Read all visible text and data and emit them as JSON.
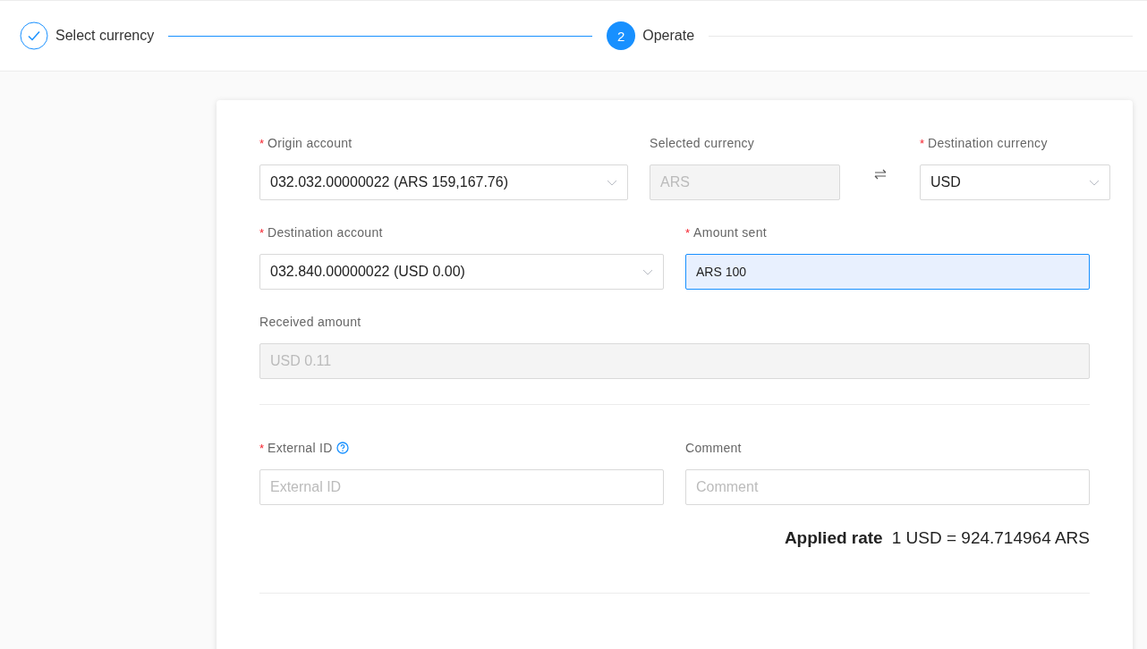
{
  "steps": [
    {
      "label": "Select currency",
      "kind": "done"
    },
    {
      "label": "Operate",
      "kind": "active",
      "number": "2"
    }
  ],
  "form": {
    "rows": [
      {
        "kind": "triple",
        "fields": [
          {
            "kind": "select",
            "label": "Origin account",
            "required_mark": "*",
            "value": "032.032.00000022 (ARS 159,167.76)"
          },
          {
            "kind": "readonly",
            "label": "Selected currency",
            "value": "ARS"
          },
          {
            "kind": "swap"
          },
          {
            "kind": "select",
            "label": "Destination currency",
            "required_mark": "*",
            "value": "USD"
          }
        ]
      },
      {
        "kind": "half",
        "fields": [
          {
            "kind": "select",
            "label": "Destination account",
            "required_mark": "*",
            "value": "032.840.00000022 (USD 0.00)"
          },
          {
            "kind": "input",
            "label": "Amount sent",
            "required_mark": "*",
            "value": "ARS 100",
            "focused": true
          }
        ]
      },
      {
        "kind": "full",
        "fields": [
          {
            "kind": "readonly",
            "label": "Received amount",
            "value": "USD 0.11"
          }
        ]
      },
      {
        "kind": "divider"
      },
      {
        "kind": "half",
        "fields": [
          {
            "kind": "input",
            "label": "External ID",
            "required_mark": "*",
            "placeholder": "External ID",
            "help": true,
            "focused": false
          },
          {
            "kind": "input",
            "label": "Comment",
            "placeholder": "Comment",
            "focused": false
          }
        ]
      }
    ],
    "rate": {
      "label": "Applied rate",
      "value": "1 USD = 924.714964 ARS"
    }
  }
}
